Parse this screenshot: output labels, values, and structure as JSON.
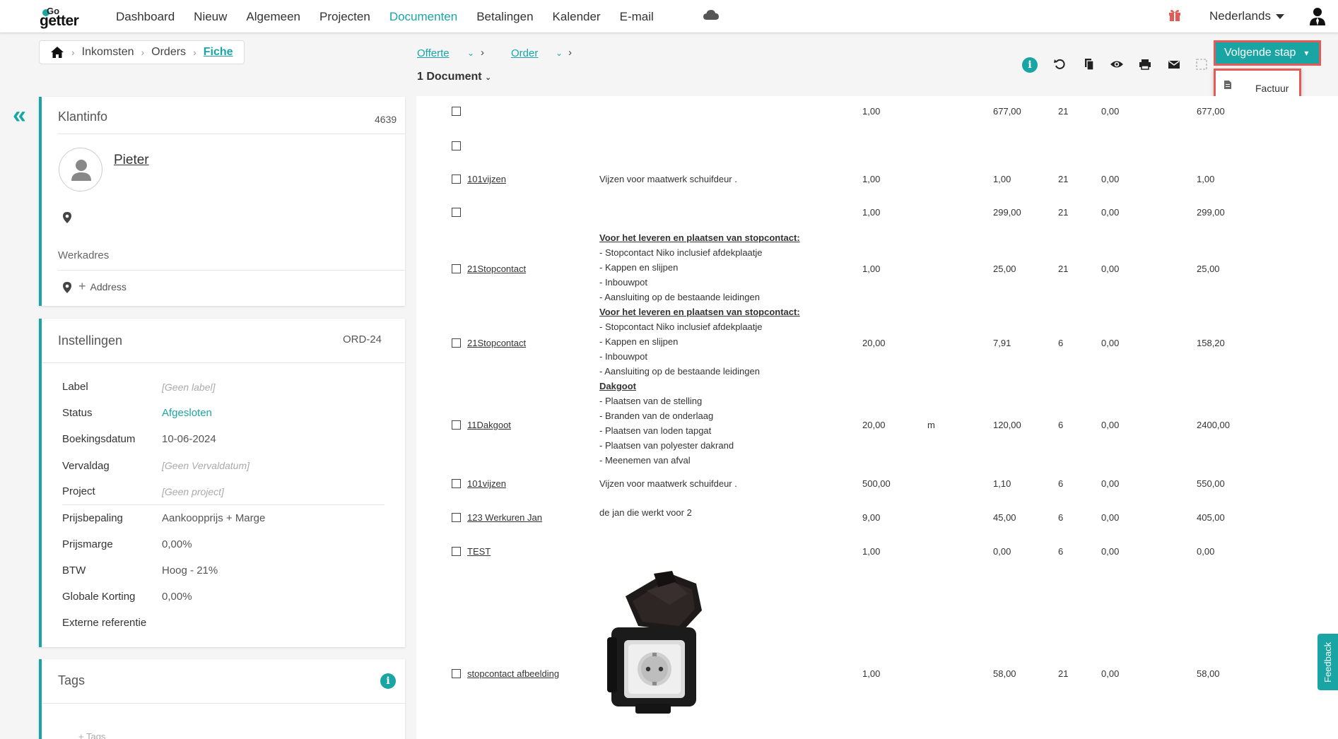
{
  "brand": {
    "logo_top": "Go",
    "logo_bottom": "getter",
    "accent": "#1aa5a5",
    "highlight": "#e35a56"
  },
  "nav": {
    "items": [
      "Dashboard",
      "Nieuw",
      "Algemeen",
      "Projecten",
      "Documenten",
      "Betalingen",
      "Kalender",
      "E-mail"
    ],
    "active": "Documenten",
    "language": "Nederlands"
  },
  "breadcrumb": {
    "items": [
      "Inkomsten",
      "Orders"
    ],
    "current": "Fiche"
  },
  "doc_header": {
    "steps": [
      "Offerte",
      "Order"
    ],
    "count_label": "1 Document"
  },
  "next_step": {
    "label": "Volgende stap",
    "options": [
      "Factuur"
    ]
  },
  "client": {
    "title": "Klantinfo",
    "number": "4639",
    "name": "Pieter",
    "work_address_label": "Werkadres",
    "add_address_label": "Address"
  },
  "settings": {
    "title": "Instellingen",
    "code": "ORD-24",
    "rows": [
      {
        "label": "Label",
        "value": "[Geen label]"
      },
      {
        "label": "Status",
        "value": "Afgesloten"
      },
      {
        "label": "Boekingsdatum",
        "value": "10-06-2024"
      },
      {
        "label": "Vervaldag",
        "value": "[Geen Vervaldatum]"
      },
      {
        "label": "Project",
        "value": "[Geen project]"
      },
      {
        "label": "Prijsbepaling",
        "value": "Aankoopprijs + Marge"
      },
      {
        "label": "Prijsmarge",
        "value": "0,00%"
      },
      {
        "label": "BTW",
        "value": "Hoog - 21%"
      },
      {
        "label": "Globale Korting",
        "value": "0,00%"
      },
      {
        "label": "Externe referentie",
        "value": ""
      }
    ]
  },
  "tags": {
    "title": "Tags",
    "add_label": "Tags"
  },
  "lines": [
    {
      "code": "",
      "qty": "1,00",
      "unit": "",
      "price": "677,00",
      "vat": "21",
      "disc": "0,00",
      "total": "677,00"
    },
    {
      "code": "",
      "qty": "",
      "unit": "",
      "price": "",
      "vat": "",
      "disc": "",
      "total": ""
    },
    {
      "code": "101vijzen",
      "desc": "Vijzen voor maatwerk schuifdeur .",
      "qty": "1,00",
      "unit": "",
      "price": "1,00",
      "vat": "21",
      "disc": "0,00",
      "total": "1,00"
    },
    {
      "code": "",
      "qty": "1,00",
      "unit": "",
      "price": "299,00",
      "vat": "21",
      "disc": "0,00",
      "total": "299,00"
    },
    {
      "code": "21Stopcontact",
      "desc_title": "Voor het leveren en plaatsen van stopcontact:",
      "desc_lines": [
        "- Stopcontact Niko inclusief afdekplaatje",
        "- Kappen en slijpen",
        "- Inbouwpot",
        "- Aansluiting op de bestaande leidingen"
      ],
      "qty": "1,00",
      "unit": "",
      "price": "25,00",
      "vat": "21",
      "disc": "0,00",
      "total": "25,00"
    },
    {
      "code": "21Stopcontact",
      "desc_title": "Voor het leveren en plaatsen van stopcontact:",
      "desc_lines": [
        "- Stopcontact Niko inclusief afdekplaatje",
        "- Kappen en slijpen",
        "- Inbouwpot",
        "- Aansluiting op de bestaande leidingen"
      ],
      "qty": "20,00",
      "unit": "",
      "price": "7,91",
      "vat": "6",
      "disc": "0,00",
      "total": "158,20"
    },
    {
      "code": "11Dakgoot",
      "desc_title": "Dakgoot",
      "desc_lines": [
        "- Plaatsen van de stelling",
        "- Branden van de onderlaag",
        "- Plaatsen van loden tapgat",
        "- Plaatsen van polyester dakrand",
        "- Meenemen van afval"
      ],
      "qty": "20,00",
      "unit": "m",
      "price": "120,00",
      "vat": "6",
      "disc": "0,00",
      "total": "2400,00"
    },
    {
      "code": "101vijzen",
      "desc": "Vijzen voor maatwerk schuifdeur .",
      "qty": "500,00",
      "unit": "",
      "price": "1,10",
      "vat": "6",
      "disc": "0,00",
      "total": "550,00"
    },
    {
      "code": "123 Werkuren Jan",
      "desc": "de jan die werkt voor 2",
      "qty": "9,00",
      "unit": "",
      "price": "45,00",
      "vat": "6",
      "disc": "0,00",
      "total": "405,00"
    },
    {
      "code": "TEST",
      "desc": "",
      "qty": "1,00",
      "unit": "",
      "price": "0,00",
      "vat": "6",
      "disc": "0,00",
      "total": "0,00"
    },
    {
      "code": "stopcontact afbeelding",
      "desc": "",
      "qty": "1,00",
      "unit": "",
      "price": "58,00",
      "vat": "21",
      "disc": "0,00",
      "total": "58,00"
    }
  ],
  "feedback_label": "Feedback"
}
